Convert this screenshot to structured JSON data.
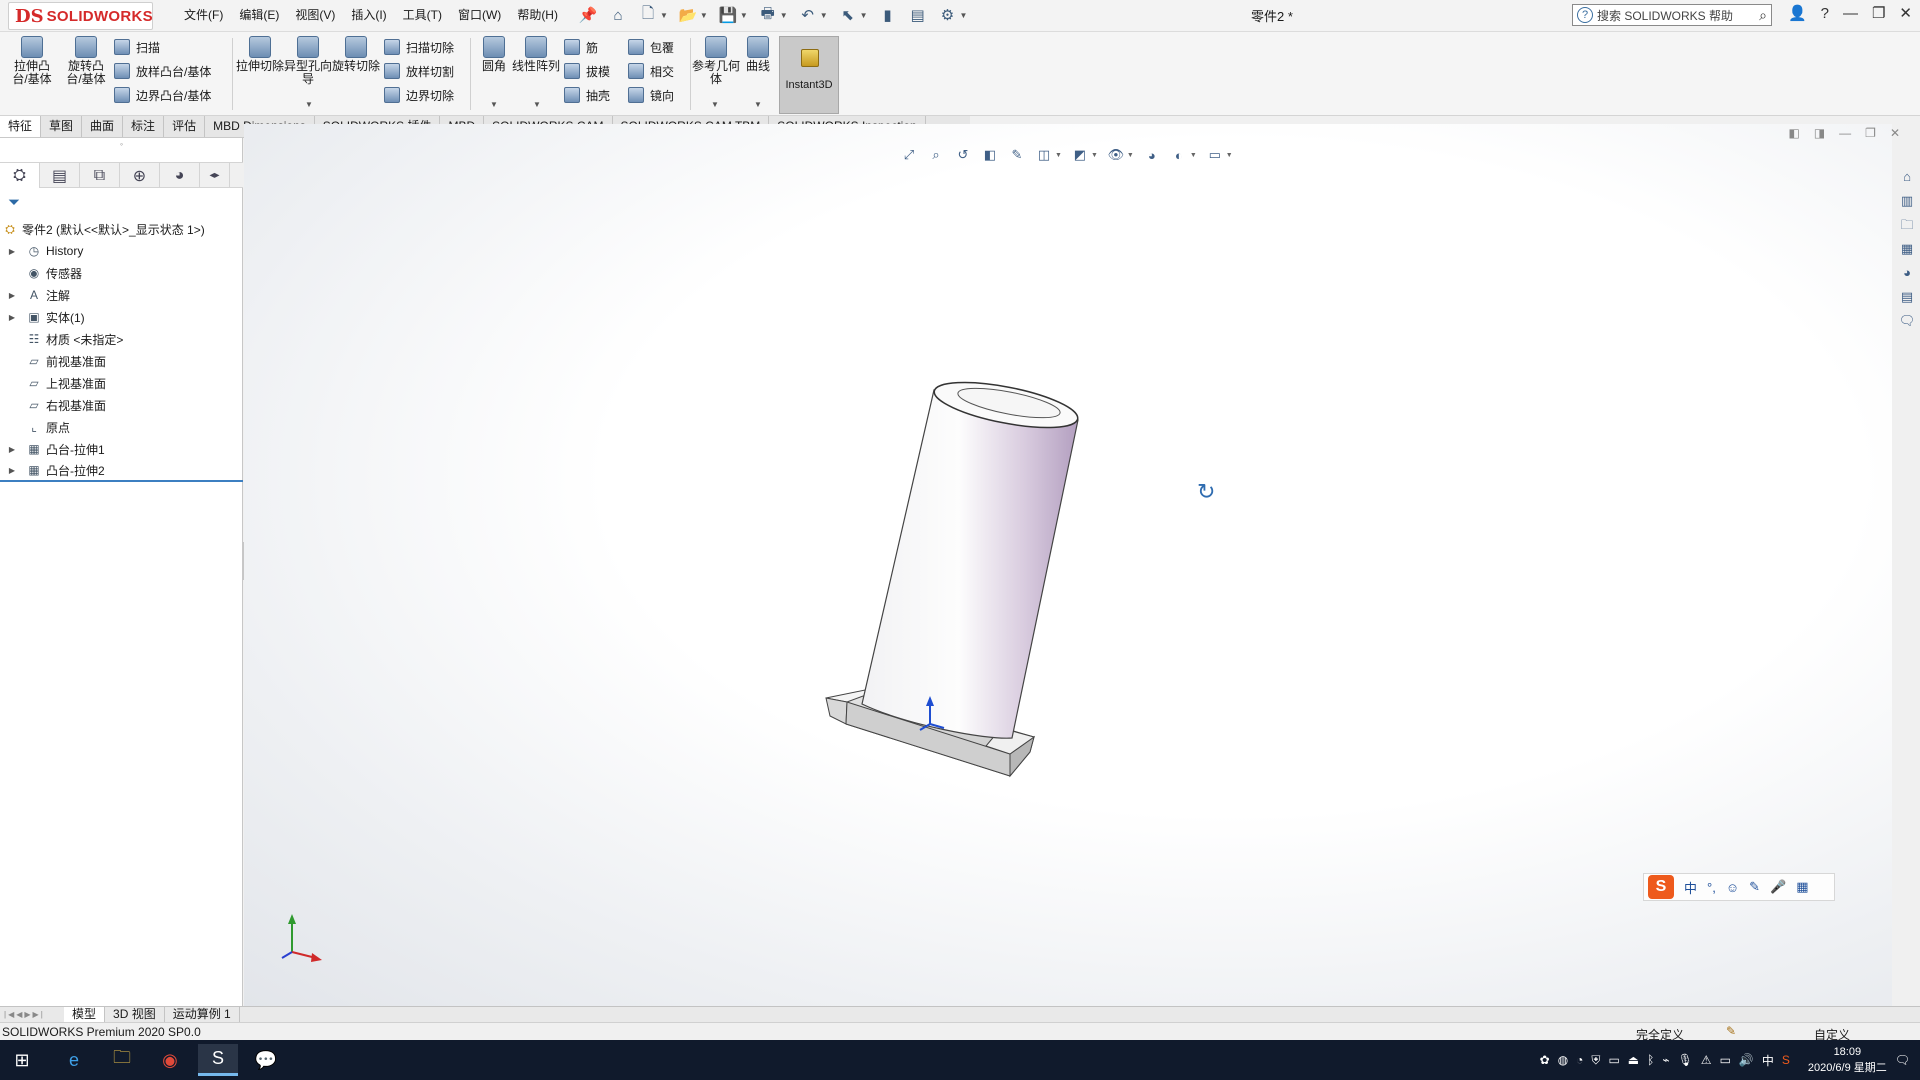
{
  "app": {
    "logo_ds": "DS",
    "logo_text": "SOLIDWORKS",
    "document_title": "零件2 *"
  },
  "menu": [
    "文件(F)",
    "编辑(E)",
    "视图(V)",
    "插入(I)",
    "工具(T)",
    "窗口(W)",
    "帮助(H)"
  ],
  "search": {
    "placeholder": "搜索 SOLIDWORKS 帮助"
  },
  "commands": {
    "extrude_boss": "拉伸凸台/基体",
    "revolve_boss": "旋转凸台/基体",
    "sweep": "扫描",
    "loft": "放样凸台/基体",
    "boundary": "边界凸台/基体",
    "extrude_cut": "拉伸切除",
    "hole_wizard": "异型孔向导",
    "revolve_cut": "旋转切除",
    "sweep_cut": "扫描切除",
    "loft_cut": "放样切割",
    "boundary_cut": "边界切除",
    "fillet": "圆角",
    "linear_pattern": "线性阵列",
    "rib": "筋",
    "draft": "拔模",
    "shell": "抽壳",
    "wrap": "包覆",
    "intersect": "相交",
    "mirror": "镜向",
    "ref_geometry": "参考几何体",
    "curves": "曲线",
    "instant3d": "Instant3D"
  },
  "tabs": [
    "特征",
    "草图",
    "曲面",
    "标注",
    "评估",
    "MBD Dimensions",
    "SOLIDWORKS 插件",
    "MBD",
    "SOLIDWORKS CAM",
    "SOLIDWORKS CAM TBM",
    "SOLIDWORKS Inspection"
  ],
  "tree": {
    "root": "零件2  (默认<<默认>_显示状态 1>)",
    "items": [
      {
        "label": "History",
        "expandable": true,
        "icon": "history-icon"
      },
      {
        "label": "传感器",
        "expandable": false,
        "icon": "sensor-icon"
      },
      {
        "label": "注解",
        "expandable": true,
        "icon": "annotation-icon"
      },
      {
        "label": "实体(1)",
        "expandable": true,
        "icon": "solid-body-icon"
      },
      {
        "label": "材质 <未指定>",
        "expandable": false,
        "icon": "material-icon"
      },
      {
        "label": "前视基准面",
        "expandable": false,
        "icon": "plane-icon"
      },
      {
        "label": "上视基准面",
        "expandable": false,
        "icon": "plane-icon"
      },
      {
        "label": "右视基准面",
        "expandable": false,
        "icon": "plane-icon"
      },
      {
        "label": "原点",
        "expandable": false,
        "icon": "origin-icon"
      },
      {
        "label": "凸台-拉伸1",
        "expandable": true,
        "icon": "extrude-feature-icon"
      },
      {
        "label": "凸台-拉伸2",
        "expandable": true,
        "icon": "extrude-feature-icon"
      }
    ]
  },
  "bottom_tabs": [
    "模型",
    "3D 视图",
    "运动算例 1"
  ],
  "status": {
    "left": "SOLIDWORKS Premium 2020 SP0.0",
    "definition": "完全定义",
    "custom": "自定义"
  },
  "taskbar": {
    "time": "18:09",
    "date": "2020/6/9 星期二",
    "ime": "中"
  },
  "ime_bar": {
    "logo": "S",
    "mode": "中"
  },
  "colors": {
    "brand": "#d52a2a",
    "selection": "#3c7fc1",
    "taskbar": "#101a2c"
  }
}
